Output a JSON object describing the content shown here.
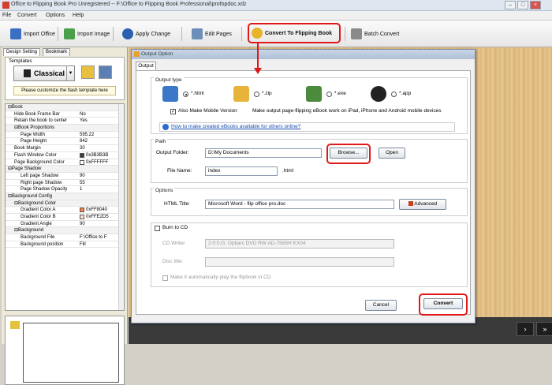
{
  "window": {
    "title": "Office to Flipping Book Pro Unregistered -- F:\\Office to Flipping Book Professional\\profopdoc.xdz",
    "controls": [
      "–",
      "□",
      "×"
    ]
  },
  "menu": [
    "File",
    "Convert",
    "Options",
    "Help"
  ],
  "toolbar": {
    "import_office": "Import Office",
    "import_image": "Import Image",
    "apply_change": "Apply Change",
    "edit_pages": "Edit Pages",
    "convert_to_flipping_book": "Convert To Flipping Book",
    "batch_convert": "Batch Convert"
  },
  "left_panel": {
    "tabs": [
      "Design Setting",
      "Bookmark"
    ],
    "templates_label": "Templates",
    "template_name": "Classical",
    "custom_note": "Please customize the flash template here",
    "properties": [
      {
        "key": "⊟Book",
        "value": "",
        "indent": 0,
        "group": true
      },
      {
        "key": "Hide Book Frame Bar",
        "value": "No",
        "indent": 1
      },
      {
        "key": "Retain the book to center",
        "value": "Yes",
        "indent": 1
      },
      {
        "key": "⊟Book Proportions",
        "value": "",
        "indent": 1,
        "group": true
      },
      {
        "key": "Page Width",
        "value": "595.22",
        "indent": 2
      },
      {
        "key": "Page Height",
        "value": "842",
        "indent": 2
      },
      {
        "key": "Book Margin",
        "value": "30",
        "indent": 1
      },
      {
        "key": "Flash Window Color",
        "value": "0x3B3B3B",
        "indent": 1,
        "swatch": "#3b3b3b"
      },
      {
        "key": "Page Background Color",
        "value": "0xFFFFFF",
        "indent": 1,
        "swatch": "#ffffff"
      },
      {
        "key": "⊟Page Shadow",
        "value": "",
        "indent": 0,
        "group": true
      },
      {
        "key": "Left page Shadow",
        "value": "90",
        "indent": 2
      },
      {
        "key": "Right page Shadow",
        "value": "55",
        "indent": 2
      },
      {
        "key": "Page Shadow Opacity",
        "value": "1",
        "indent": 2
      },
      {
        "key": "⊟Background Config",
        "value": "",
        "indent": 0,
        "group": true
      },
      {
        "key": "⊟Background Color",
        "value": "",
        "indent": 1,
        "group": true
      },
      {
        "key": "Gradient Color A",
        "value": "0xFF8040",
        "indent": 2,
        "swatch": "#ff8040"
      },
      {
        "key": "Gradient Color B",
        "value": "0xFFE2D5",
        "indent": 2,
        "swatch": "#ffe2d5"
      },
      {
        "key": "Gradient Angle",
        "value": "90",
        "indent": 2
      },
      {
        "key": "⊟Background",
        "value": "",
        "indent": 1,
        "group": true
      },
      {
        "key": "Background File",
        "value": "F:\\Office to F",
        "indent": 2
      },
      {
        "key": "Background position",
        "value": "Fill",
        "indent": 2
      }
    ]
  },
  "dialog": {
    "title": "Output Option",
    "tab": "Output",
    "output_type": {
      "label": "Output type",
      "options": [
        "*.html",
        "*.zip",
        "*.exe",
        "*.app"
      ],
      "selected": "*.html",
      "mobile_checkbox": "Also Make Mobile Version",
      "mobile_note": "Make output page-flipping eBook work on iPad, iPhone and Android mobile devices",
      "help_link": "How to make created eBooks available for others online?"
    },
    "path": {
      "label": "Path",
      "output_folder_label": "Output Folder:",
      "output_folder_value": "D:\\My Documents",
      "browse": "Browse...",
      "open": "Open",
      "file_name_label": "File Name:",
      "file_name_value": "index",
      "extension": ".html"
    },
    "options": {
      "label": "Options",
      "html_title_label": "HTML Title:",
      "html_title_value": "Microsoft Word - flip office pro.doc",
      "advanced": "Advanced"
    },
    "burn": {
      "checkbox_label": "Burn to CD",
      "cd_writer_label": "CD Writer",
      "cd_writer_value": "2:0:0,G: Optiarc  DVD RW AD-7585H  KX04",
      "disc_title_label": "Disc title:",
      "autoplay_label": "Make it automatically play the flipbook in CD"
    },
    "cancel": "Cancel",
    "convert": "Convert"
  },
  "viewer_nav": {
    "next": "›",
    "last": "»"
  },
  "colors": {
    "highlight": "#e01818",
    "accent_link": "#1a4fb0"
  }
}
